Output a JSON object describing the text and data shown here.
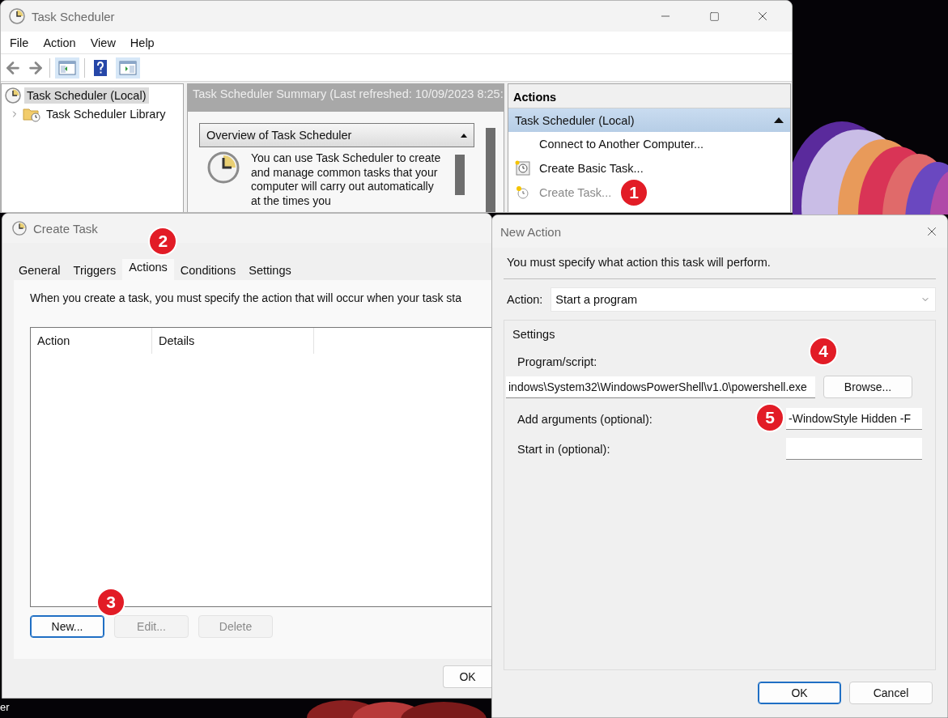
{
  "desktop": {
    "icon_label": "er"
  },
  "main_window": {
    "title": "Task Scheduler",
    "menu": [
      "File",
      "Action",
      "View",
      "Help"
    ],
    "tree": [
      {
        "label": "Task Scheduler (Local)",
        "selected": true,
        "children": [
          {
            "label": "Task Scheduler Library",
            "selected": false,
            "expanded": false
          }
        ]
      }
    ],
    "summary": {
      "title": "Task Scheduler Summary (Last refreshed: 10/09/2023 8:25:",
      "overview_title": "Overview of Task Scheduler",
      "overview_text": "You can use Task Scheduler to create and manage common tasks that your computer will carry out automatically at the times you"
    },
    "actions": {
      "title": "Actions",
      "group": "Task Scheduler (Local)",
      "items": [
        {
          "label": "Connect to Another Computer...",
          "kind": "plain",
          "disabled": false
        },
        {
          "label": "Create Basic Task...",
          "kind": "basic",
          "disabled": false
        },
        {
          "label": "Create Task...",
          "kind": "task",
          "disabled": true,
          "badge": "1"
        }
      ]
    }
  },
  "create_task": {
    "title": "Create Task",
    "tabs": [
      {
        "label": "General",
        "selected": false
      },
      {
        "label": "Triggers",
        "selected": false
      },
      {
        "label": "Actions",
        "selected": true,
        "badge": "2"
      },
      {
        "label": "Conditions",
        "selected": false
      },
      {
        "label": "Settings",
        "selected": false
      }
    ],
    "description": "When you create a task, you must specify the action that will occur when your task sta",
    "columns": [
      "Action",
      "Details"
    ],
    "buttons": [
      {
        "label": "New...",
        "disabled": false,
        "default": true,
        "badge": "3"
      },
      {
        "label": "Edit...",
        "disabled": true,
        "default": false
      },
      {
        "label": "Delete",
        "disabled": true,
        "default": false
      }
    ],
    "footer_button": "OK"
  },
  "new_action": {
    "title": "New Action",
    "instruction": "You must specify what action this task will perform.",
    "action_label": "Action:",
    "action_value": "Start a program",
    "settings_title": "Settings",
    "fields": [
      {
        "kind": "stacked",
        "label": "Program/script:",
        "value": "indows\\System32\\WindowsPowerShell\\v1.0\\powershell.exe",
        "button": "Browse...",
        "badge": "4"
      },
      {
        "kind": "inline",
        "label": "Add arguments (optional):",
        "value": "-WindowStyle Hidden -F",
        "badge": "5"
      },
      {
        "kind": "inline",
        "label": "Start in (optional):"
      }
    ],
    "buttons": [
      {
        "label": "OK",
        "default": true
      },
      {
        "label": "Cancel",
        "default": false
      }
    ]
  }
}
